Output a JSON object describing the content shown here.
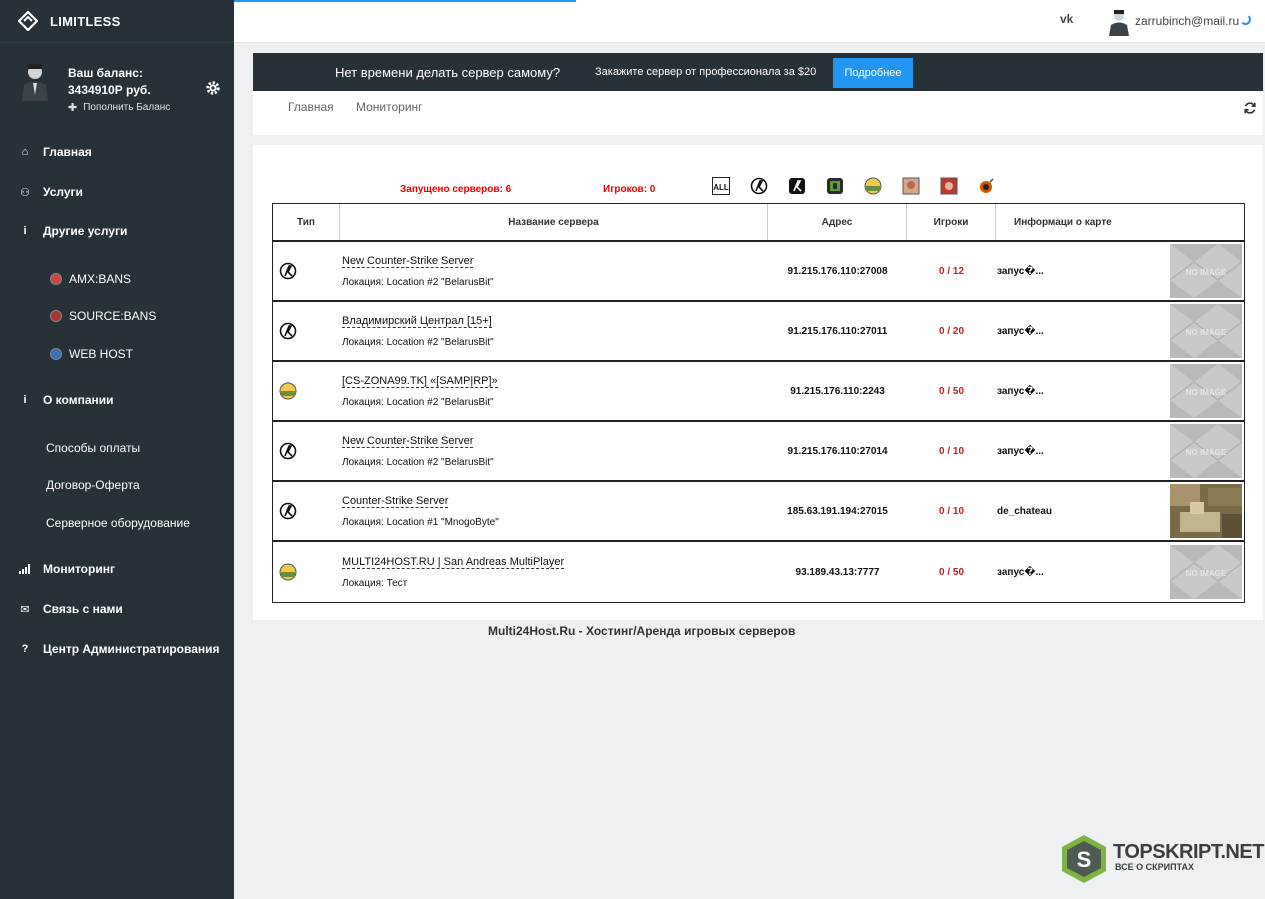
{
  "brand": {
    "name": "LIMITLESS"
  },
  "user": {
    "balance_label": "Ваш баланс:",
    "balance_value": "3434910Р руб.",
    "topup_label": "Пополнить Баланс"
  },
  "nav": {
    "main": "Главная",
    "services": "Услуги",
    "other_services": "Другие услуги",
    "amx": "AMX:BANS",
    "source": "SOURCE:BANS",
    "webhost": "WEB HOST",
    "about": "О компании",
    "payment": "Способы оплаты",
    "offer": "Договор-Оферта",
    "hardware": "Серверное оборудование",
    "monitoring": "Мониторинг",
    "contact": "Связь с нами",
    "admin": "Центр Администратирования"
  },
  "topbar": {
    "vk": "vk",
    "email": "zarrubinch@mail.ru"
  },
  "promo": {
    "question": "Нет времени делать сервер самому?",
    "text": "Закажите сервер от профессионала за $20",
    "button": "Подробнее"
  },
  "breadcrumbs": [
    "Главная",
    "Мониторинг"
  ],
  "stats": {
    "servers": "Запущено серверов: 6",
    "players": "Игроков: 0"
  },
  "filter_all": "ALL",
  "table": {
    "headers": [
      "Тип",
      "Название сервера",
      "Адрес",
      "Игроки",
      "Информаци о карте"
    ],
    "rows": [
      {
        "game": "cs",
        "name": "New Counter-Strike Server",
        "location": "Локация: Location #2 \"BelarusBit\"",
        "address": "91.215.176.110:27008",
        "players": "0 / 12",
        "map": "запус�...",
        "thumb": "NO IMAGE"
      },
      {
        "game": "cs",
        "name": "Владимирский Централ [15+]",
        "location": "Локация: Location #2 \"BelarusBit\"",
        "address": "91.215.176.110:27011",
        "players": "0 / 20",
        "map": "запус�...",
        "thumb": "NO IMAGE"
      },
      {
        "game": "samp",
        "name": "[CS-ZONA99.TK] «[SAMP|RP]»",
        "location": "Локация: Location #2 \"BelarusBit\"",
        "address": "91.215.176.110:2243",
        "players": "0 / 50",
        "map": "запус�...",
        "thumb": "NO IMAGE"
      },
      {
        "game": "cs",
        "name": "New Counter-Strike Server",
        "location": "Локация: Location #2 \"BelarusBit\"",
        "address": "91.215.176.110:27014",
        "players": "0 / 10",
        "map": "запус�...",
        "thumb": "NO IMAGE"
      },
      {
        "game": "cs",
        "name": "Counter-Strike Server",
        "location": "Локация: Location #1 \"MnogoByte\"",
        "address": "185.63.191.194:27015",
        "players": "0 / 10",
        "map": "de_chateau",
        "thumb": "map"
      },
      {
        "game": "samp",
        "name": "MULTI24HOST.RU | San Andreas MultiPlayer",
        "location": "Локация: Тест",
        "address": "93.189.43.13:7777",
        "players": "0 / 50",
        "map": "запус�...",
        "thumb": "NO IMAGE"
      }
    ]
  },
  "footer": "Multi24Host.Ru - Хостинг/Аренда игровых серверов",
  "watermark": {
    "big": "TOPSKRIPT.NET",
    "small": "ВСЕ О СКРИПТАХ"
  },
  "colors": {
    "sidebar": "#263238",
    "accent": "#2196f3",
    "stat_red": "#ee0000",
    "players": "#bb2222"
  }
}
